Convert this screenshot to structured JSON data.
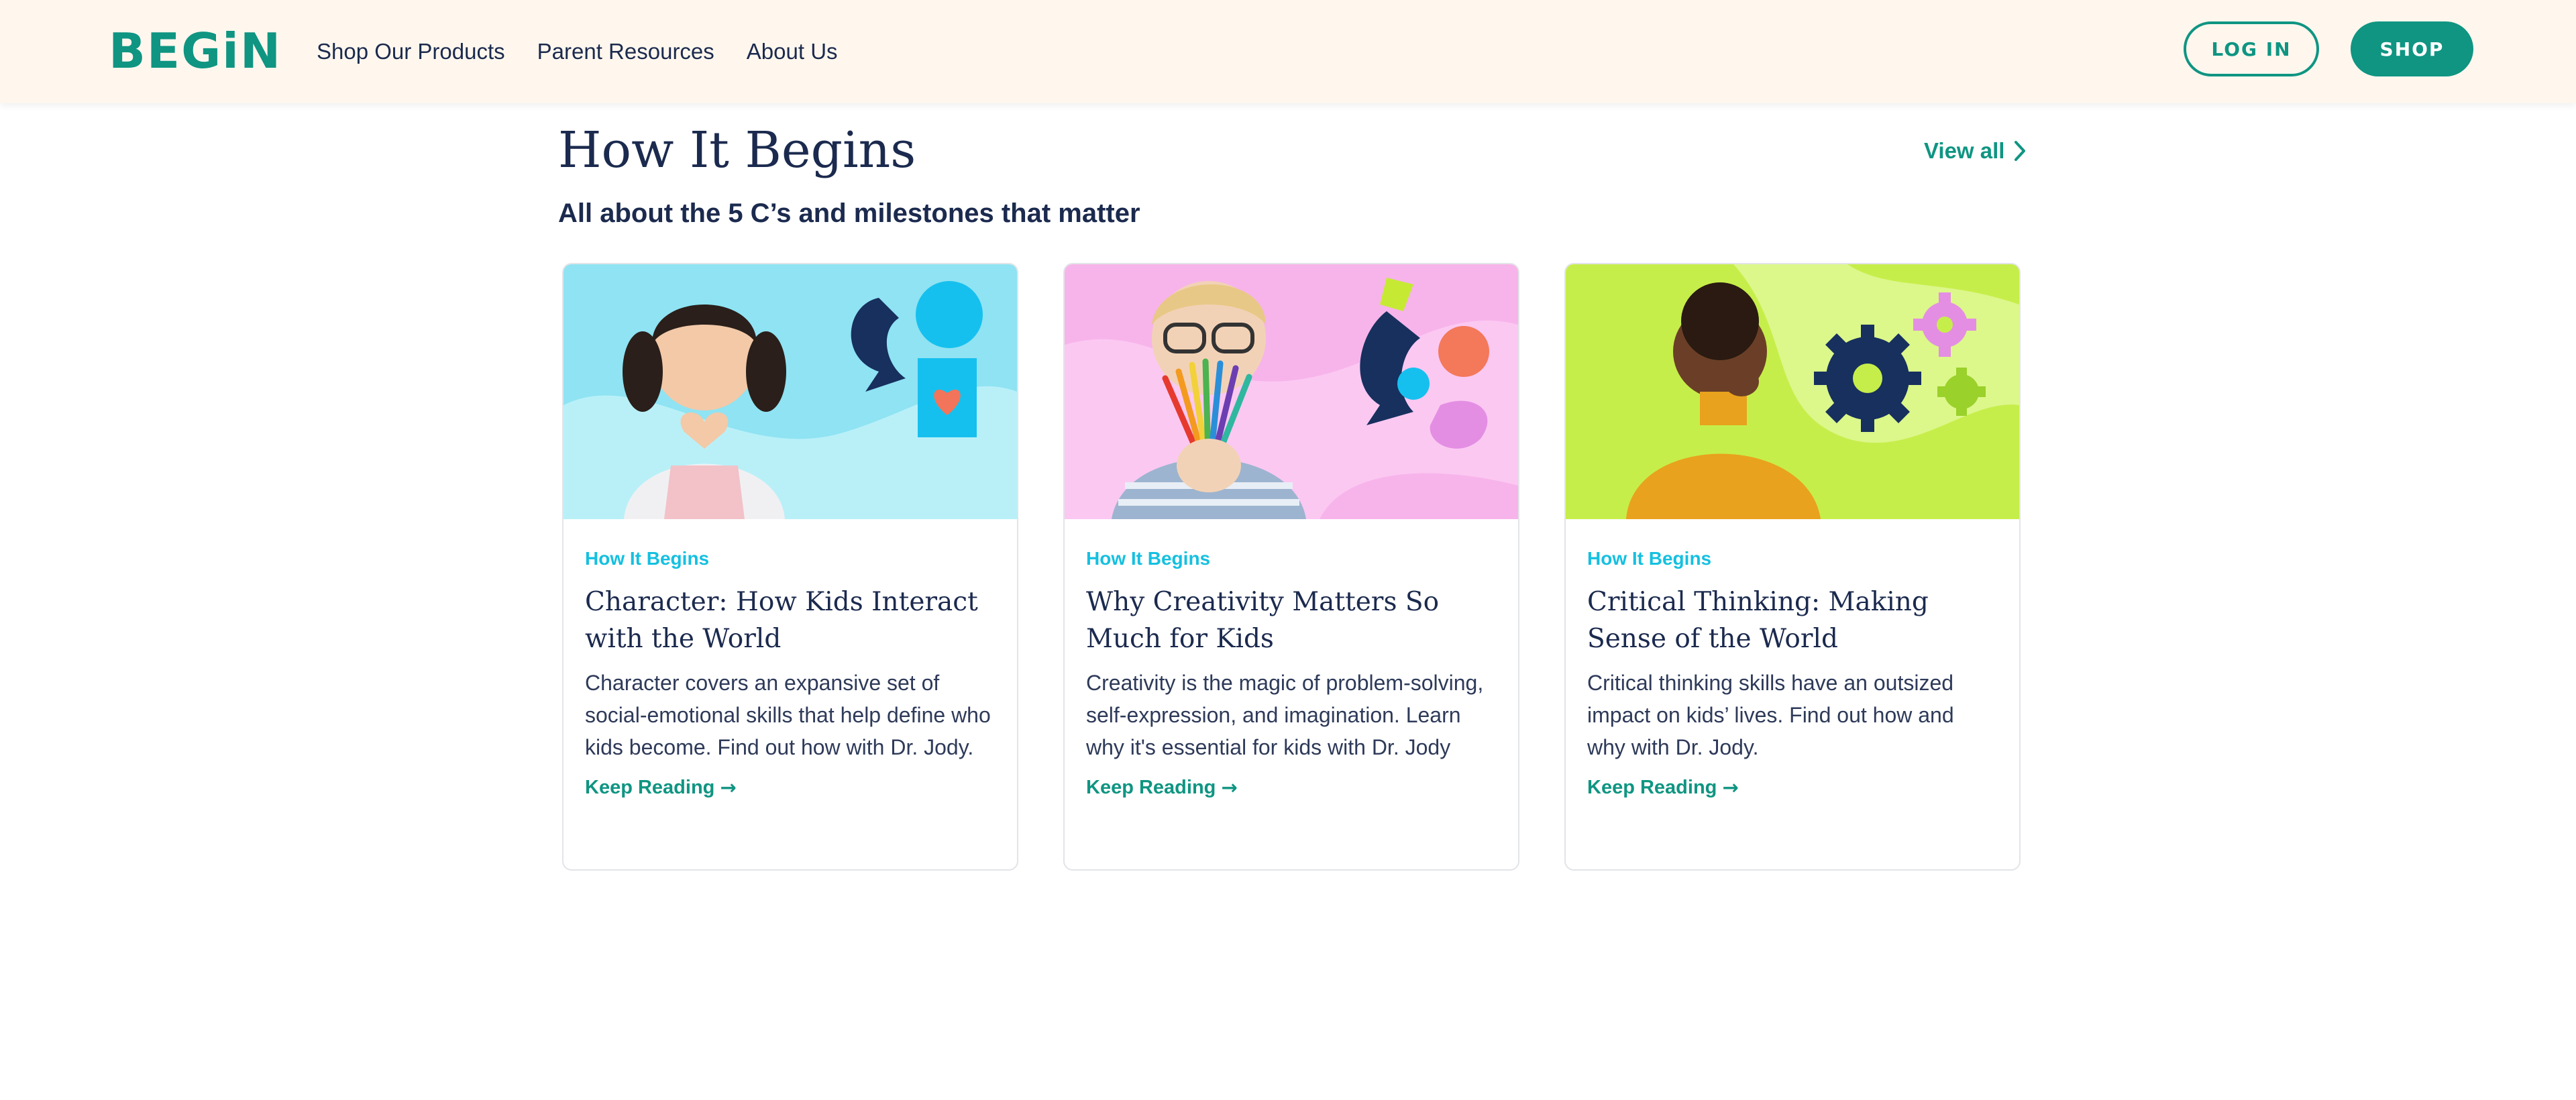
{
  "header": {
    "logo": "BEGiN",
    "nav": [
      "Shop Our Products",
      "Parent Resources",
      "About Us"
    ],
    "login_label": "LOG IN",
    "shop_label": "SHOP"
  },
  "section": {
    "title": "How It Begins",
    "subtitle": "All about the 5 C’s and milestones that matter",
    "view_all": "View all"
  },
  "cards": [
    {
      "category": "How It Begins",
      "title": "Character: How Kids Interact with the World",
      "description": "Character covers an expansive set of social-emotional skills that help define who kids become. Find out how with Dr. Jody.",
      "link": "Keep Reading",
      "image_icon": "child-heart-hands-image"
    },
    {
      "category": "How It Begins",
      "title": "Why Creativity Matters So Much for Kids",
      "description": "Creativity is the magic of problem-solving, self-expression, and imagination. Learn why it's essential for kids with Dr. Jody",
      "link": "Keep Reading",
      "image_icon": "child-colored-pencils-image"
    },
    {
      "category": "How It Begins",
      "title": "Critical Thinking: Making Sense of the World",
      "description": "Critical thinking skills have an outsized impact on kids’ lives. Find out how and why with Dr. Jody.",
      "link": "Keep Reading",
      "image_icon": "child-thinking-gears-image"
    }
  ],
  "colors": {
    "brand": "#0f9582",
    "navy": "#1b2a4e",
    "category": "#15c0e0",
    "header_bg": "#fff7ee"
  }
}
